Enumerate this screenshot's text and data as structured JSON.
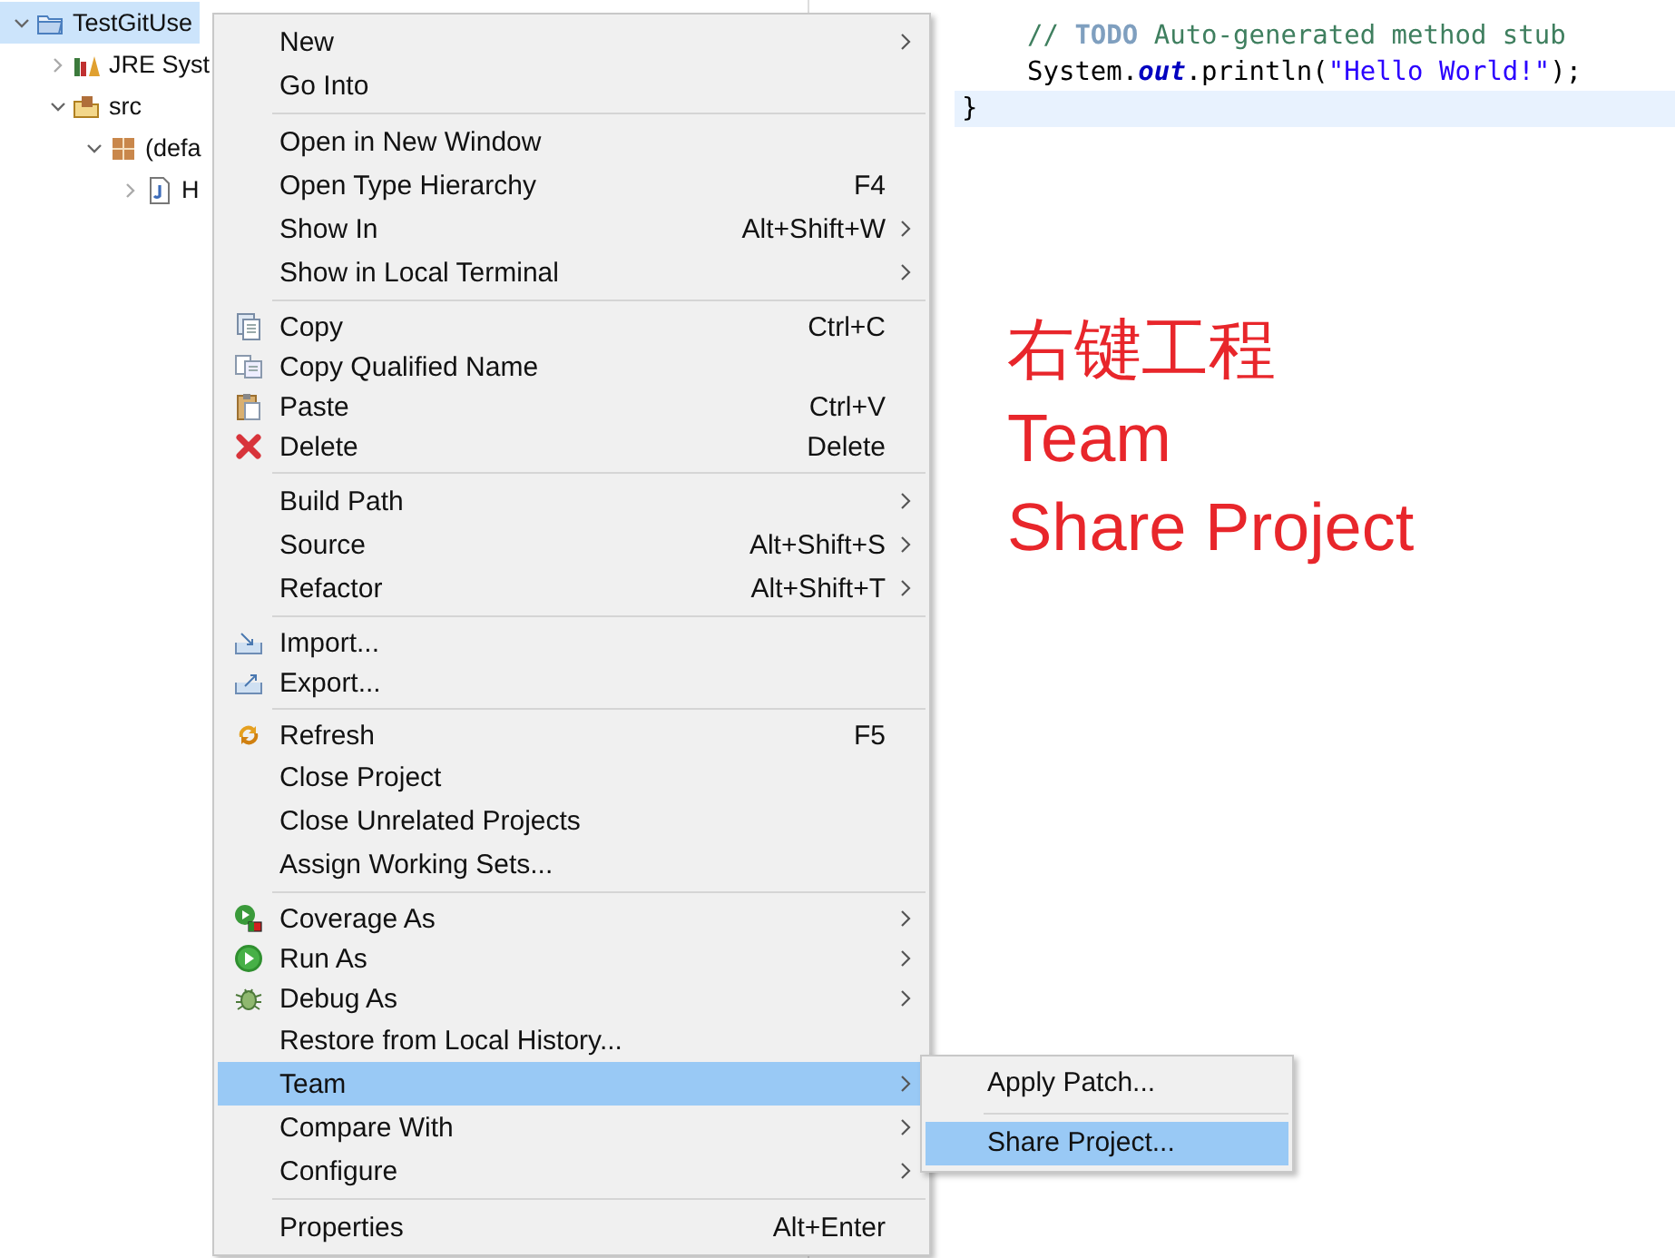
{
  "tree": [
    {
      "label": "TestGitUse",
      "kind": "project",
      "expanded": true,
      "selected": true,
      "children": [
        {
          "label": "JRE Syst",
          "kind": "library",
          "expanded": false,
          "selected": false
        },
        {
          "label": "src",
          "kind": "source-folder",
          "expanded": true,
          "selected": false,
          "children": [
            {
              "label": "(defa",
              "kind": "package",
              "expanded": true,
              "selected": false,
              "children": [
                {
                  "label": "H",
                  "kind": "java-file",
                  "expanded": false,
                  "selected": false
                }
              ]
            }
          ]
        }
      ]
    }
  ],
  "editor": {
    "lines": [
      {
        "kind": "statement",
        "current": false,
        "segments": [
          {
            "kind": "comment",
            "text": "// "
          },
          {
            "kind": "todo",
            "text": "TODO"
          },
          {
            "kind": "comment",
            "text": " Auto-generated method stub"
          }
        ]
      },
      {
        "kind": "statement",
        "current": false,
        "segments": [
          {
            "kind": "plain",
            "text": "System."
          },
          {
            "kind": "field",
            "text": "out"
          },
          {
            "kind": "plain",
            "text": ".println("
          },
          {
            "kind": "string",
            "text": "\"Hello World!\""
          },
          {
            "kind": "plain",
            "text": ");"
          }
        ]
      },
      {
        "kind": "brace",
        "current": true,
        "segments": [
          {
            "kind": "plain",
            "text": "}"
          }
        ]
      }
    ]
  },
  "context_menu": {
    "groups": [
      [
        {
          "label": "New",
          "submenu": true,
          "selected": false
        },
        {
          "label": "Go Into",
          "submenu": false,
          "selected": false
        }
      ],
      [
        {
          "label": "Open in New Window",
          "submenu": false,
          "selected": false
        },
        {
          "label": "Open Type Hierarchy",
          "shortcut": "F4",
          "submenu": false,
          "selected": false
        },
        {
          "label": "Show In",
          "shortcut": "Alt+Shift+W",
          "submenu": true,
          "selected": false
        },
        {
          "label": "Show in Local Terminal",
          "submenu": true,
          "selected": false
        }
      ],
      [
        {
          "label": "Copy",
          "kind": "copy",
          "shortcut": "Ctrl+C",
          "submenu": false,
          "selected": false
        },
        {
          "label": "Copy Qualified Name",
          "kind": "copy-qualified",
          "submenu": false,
          "selected": false
        },
        {
          "label": "Paste",
          "kind": "paste",
          "shortcut": "Ctrl+V",
          "submenu": false,
          "selected": false
        },
        {
          "label": "Delete",
          "kind": "delete",
          "shortcut": "Delete",
          "submenu": false,
          "selected": false
        }
      ],
      [
        {
          "label": "Build Path",
          "submenu": true,
          "selected": false
        },
        {
          "label": "Source",
          "shortcut": "Alt+Shift+S",
          "submenu": true,
          "selected": false
        },
        {
          "label": "Refactor",
          "shortcut": "Alt+Shift+T",
          "submenu": true,
          "selected": false
        }
      ],
      [
        {
          "label": "Import...",
          "kind": "import",
          "submenu": false,
          "selected": false
        },
        {
          "label": "Export...",
          "kind": "export",
          "submenu": false,
          "selected": false
        }
      ],
      [
        {
          "label": "Refresh",
          "kind": "refresh",
          "shortcut": "F5",
          "submenu": false,
          "selected": false
        },
        {
          "label": "Close Project",
          "submenu": false,
          "selected": false
        },
        {
          "label": "Close Unrelated Projects",
          "submenu": false,
          "selected": false
        },
        {
          "label": "Assign Working Sets...",
          "submenu": false,
          "selected": false
        }
      ],
      [
        {
          "label": "Coverage As",
          "kind": "coverage",
          "submenu": true,
          "selected": false
        },
        {
          "label": "Run As",
          "kind": "run",
          "submenu": true,
          "selected": false
        },
        {
          "label": "Debug As",
          "kind": "debug",
          "submenu": true,
          "selected": false
        },
        {
          "label": "Restore from Local History...",
          "submenu": false,
          "selected": false
        },
        {
          "label": "Team",
          "submenu": true,
          "selected": true
        },
        {
          "label": "Compare With",
          "submenu": true,
          "selected": false
        },
        {
          "label": "Configure",
          "submenu": true,
          "selected": false
        }
      ],
      [
        {
          "label": "Properties",
          "shortcut": "Alt+Enter",
          "submenu": false,
          "selected": false
        }
      ]
    ]
  },
  "submenu": {
    "groups": [
      [
        {
          "label": "Apply Patch...",
          "selected": false
        }
      ],
      [
        {
          "label": "Share Project...",
          "selected": true
        }
      ]
    ]
  },
  "annotation": [
    "右键工程",
    "Team",
    "Share Project"
  ]
}
